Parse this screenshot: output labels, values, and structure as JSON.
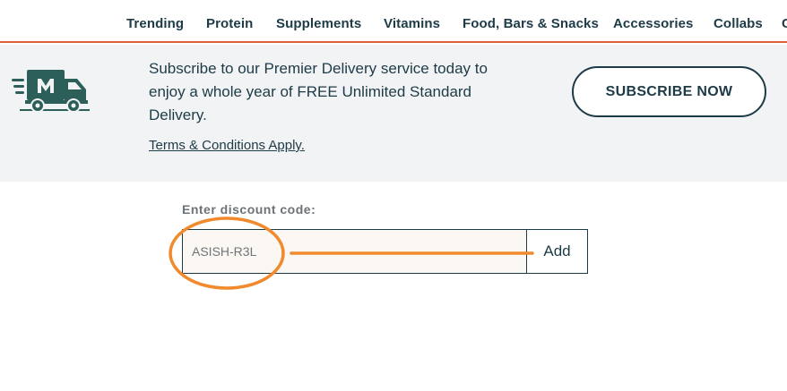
{
  "nav": {
    "items": [
      {
        "label": "Trending"
      },
      {
        "label": "Protein"
      },
      {
        "label": "Supplements"
      },
      {
        "label": "Vitamins"
      },
      {
        "label": "Food, Bars & Snacks"
      },
      {
        "label": "Accessories"
      },
      {
        "label": "Collabs"
      },
      {
        "label": "C"
      }
    ]
  },
  "banner": {
    "icon": "delivery-truck-icon",
    "text": "Subscribe to our Premier Delivery service today to enjoy a whole year of FREE Unlimited Standard Delivery.",
    "terms_link": "Terms & Conditions Apply.",
    "subscribe_label": "SUBSCRIBE NOW"
  },
  "discount": {
    "label": "Enter discount code:",
    "value": "ASISH-R3L",
    "add_label": "Add"
  },
  "colors": {
    "brand_dark": "#1d3b47",
    "nav_underline": "#e0623a",
    "annotation": "#f08a2c",
    "banner_bg": "#f2f3f5"
  }
}
